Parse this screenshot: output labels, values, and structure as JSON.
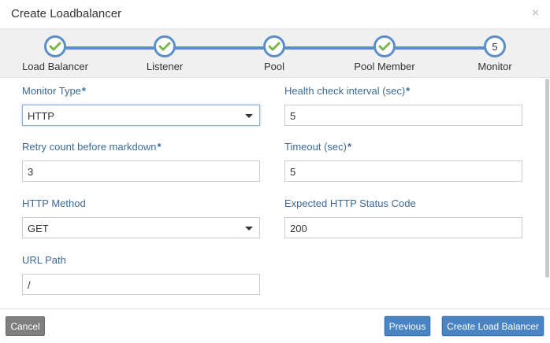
{
  "dialog": {
    "title": "Create Loadbalancer",
    "close_glyph": "×"
  },
  "wizard": {
    "steps": [
      {
        "label": "Load Balancer",
        "state": "complete",
        "icon": "check-icon"
      },
      {
        "label": "Listener",
        "state": "complete",
        "icon": "check-icon"
      },
      {
        "label": "Pool",
        "state": "complete",
        "icon": "check-icon"
      },
      {
        "label": "Pool Member",
        "state": "complete",
        "icon": "check-icon"
      },
      {
        "label": "Monitor",
        "state": "current",
        "number": "5"
      }
    ],
    "accent_color": "#5b8fc7",
    "check_color": "#7ab648"
  },
  "form": {
    "monitor_type": {
      "label": "Monitor Type",
      "required": "*",
      "value": "HTTP"
    },
    "health_check_interval": {
      "label": "Health check interval (sec)",
      "required": "*",
      "value": "5"
    },
    "retry_count": {
      "label": "Retry count before markdown",
      "required": "*",
      "value": "3"
    },
    "timeout": {
      "label": "Timeout (sec)",
      "required": "*",
      "value": "5"
    },
    "http_method": {
      "label": "HTTP Method",
      "value": "GET"
    },
    "expected_status": {
      "label": "Expected HTTP Status Code",
      "value": "200"
    },
    "url_path": {
      "label": "URL Path",
      "value": "/"
    }
  },
  "footer": {
    "cancel_label": "Cancel",
    "previous_label": "Previous",
    "create_label": "Create Load Balancer"
  }
}
